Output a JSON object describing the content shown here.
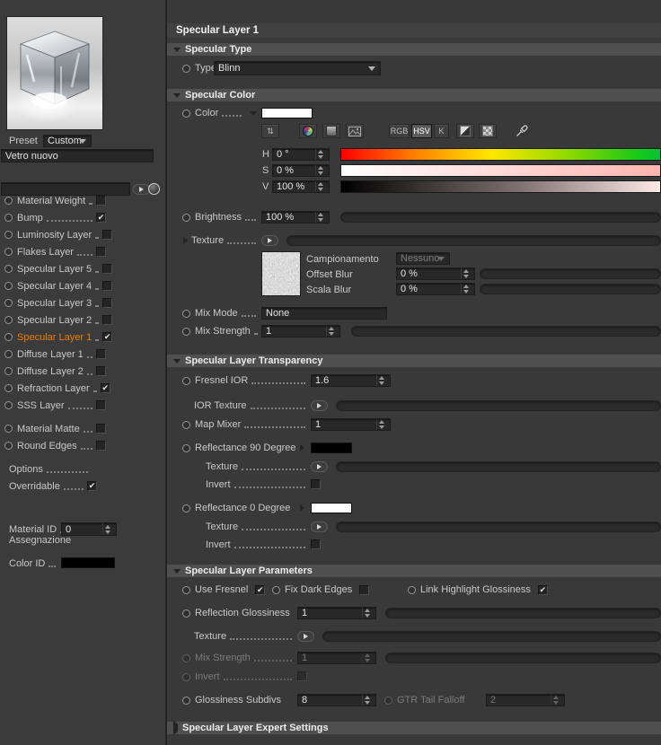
{
  "colors": {
    "accent_orange": "#f07d00",
    "panel_bg": "#3b3b3b",
    "section_header_bg": "#4f4f4f",
    "field_bg": "#282828",
    "specular_color_swatch": "#ffffff",
    "reflectance_90_swatch": "#000000",
    "reflectance_0_swatch": "#ffffff",
    "color_id_swatch": "#000000"
  },
  "icons": {
    "compact_picker_glyph": "⇅",
    "window_glyph": "▦"
  },
  "sidebar": {
    "preset_label": "Preset",
    "preset_value": "Custom",
    "material_name": "Vetro nuovo",
    "channels": [
      {
        "label": "Material Weight",
        "check": ""
      },
      {
        "label": "Bump",
        "check": "✔"
      },
      {
        "label": "Luminosity Layer",
        "check": ""
      },
      {
        "label": "Flakes Layer",
        "check": ""
      },
      {
        "label": "Specular Layer 5",
        "check": ""
      },
      {
        "label": "Specular Layer 4",
        "check": ""
      },
      {
        "label": "Specular Layer 3",
        "check": ""
      },
      {
        "label": "Specular Layer 2",
        "check": ""
      },
      {
        "label": "Specular Layer 1",
        "check": "✔",
        "selected": true
      },
      {
        "label": "Diffuse Layer 1",
        "check": ""
      },
      {
        "label": "Diffuse Layer 2",
        "check": ""
      },
      {
        "label": "Refraction Layer",
        "check": "✔"
      },
      {
        "label": "SSS Layer",
        "check": ""
      }
    ],
    "extras": [
      {
        "label": "Material Matte",
        "check": ""
      },
      {
        "label": "Round Edges",
        "check": ""
      }
    ],
    "options_label": "Options",
    "overridable": {
      "label": "Overridable",
      "check": "✔"
    },
    "material_id": {
      "label": "Material ID",
      "value": "0"
    },
    "color_id": {
      "label": "Color ID"
    },
    "assign_label": "Assegnazione"
  },
  "main": {
    "title": "Specular Layer 1",
    "type_section": {
      "header": "Specular Type",
      "type_label": "Type",
      "type_value": "Blinn"
    },
    "color_section": {
      "header": "Specular Color",
      "color_label": "Color",
      "mode_rgb": "RGB",
      "mode_hsv": "HSV",
      "mode_k": "K",
      "h_label": "H",
      "h_value": "0 °",
      "s_label": "S",
      "s_value": "0 %",
      "v_label": "V",
      "v_value": "100 %",
      "brightness_label": "Brightness",
      "brightness_value": "100 %",
      "texture_label": "Texture",
      "sampling_label": "Campionamento",
      "sampling_value": "Nessuno",
      "offset_blur_label": "Offset Blur",
      "offset_blur_value": "0 %",
      "scale_blur_label": "Scala Blur",
      "scale_blur_value": "0 %",
      "mix_mode_label": "Mix Mode",
      "mix_mode_value": "None",
      "mix_strength_label": "Mix Strength",
      "mix_strength_value": "1"
    },
    "transparency_section": {
      "header": "Specular Layer Transparency",
      "fresnel_ior_label": "Fresnel IOR",
      "fresnel_ior_value": "1.6",
      "ior_texture_label": "IOR Texture",
      "map_mixer_label": "Map Mixer",
      "map_mixer_value": "1",
      "refl90_label": "Reflectance 90 Degree",
      "texture90_label": "Texture",
      "invert90_label": "Invert",
      "invert90_check": "",
      "refl0_label": "Reflectance 0 Degree",
      "texture0_label": "Texture",
      "invert0_label": "Invert",
      "invert0_check": ""
    },
    "params_section": {
      "header": "Specular Layer Parameters",
      "use_fresnel_label": "Use Fresnel",
      "use_fresnel_check": "✔",
      "fix_dark_edges_label": "Fix Dark Edges",
      "fix_dark_edges_check": "",
      "link_highlight_label": "Link Highlight Glossiness",
      "link_highlight_check": "✔",
      "reflection_glossiness_label": "Reflection Glossiness",
      "reflection_glossiness_value": "1",
      "texture_label": "Texture",
      "mix_strength_label": "Mix Strength",
      "mix_strength_value": "1",
      "invert_label": "Invert",
      "invert_check": "",
      "glossiness_subdivs_label": "Glossiness Subdivs",
      "glossiness_subdivs_value": "8",
      "gtr_label": "GTR Tail Falloff",
      "gtr_value": "2"
    },
    "expert_section": {
      "header": "Specular Layer Expert Settings"
    }
  }
}
